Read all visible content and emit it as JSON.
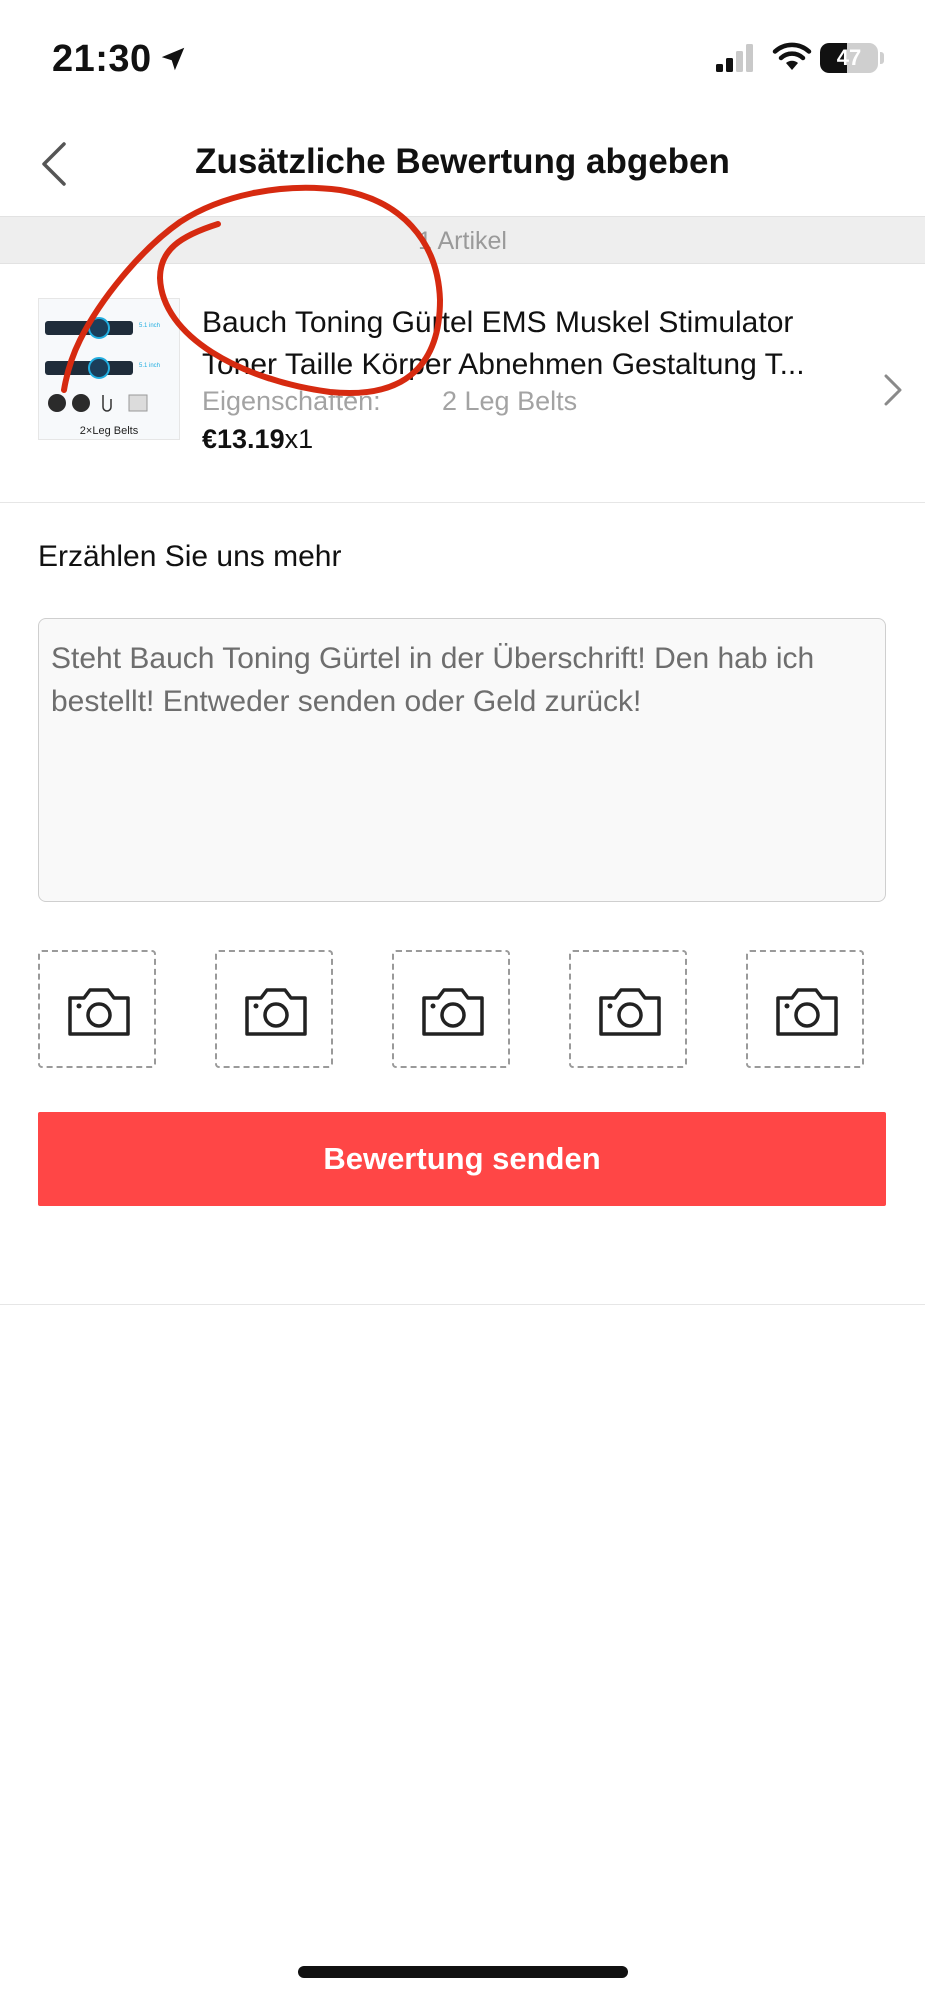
{
  "status_bar": {
    "time": "21:30",
    "battery_level": "47",
    "battery_fraction": 0.47,
    "icons": [
      "location-arrow-icon",
      "cellular-signal-icon",
      "wifi-icon",
      "battery-icon"
    ]
  },
  "header": {
    "title": "Zusätzliche Bewertung abgeben",
    "back_icon": "chevron-left-icon"
  },
  "section": {
    "label": "1 Artikel"
  },
  "product": {
    "title_line1": "Bauch Toning Gürtel EMS Muskel Stimulator",
    "title_line2": "Toner Taille Körper Abnehmen Gestaltung T...",
    "attribute_label": "Eigenschaften:",
    "attribute_value": "2 Leg Belts",
    "price": "€13.19",
    "quantity": "x1",
    "image_caption": "2×Leg Belts",
    "chevron_icon": "chevron-right-icon"
  },
  "review": {
    "label": "Erzählen Sie uns mehr",
    "text": "Steht Bauch Toning Gürtel in der Überschrift! Den hab ich bestellt! Entweder senden oder Geld zurück!"
  },
  "photos": {
    "slot_count": 5,
    "icon": "camera-icon"
  },
  "submit": {
    "label": "Bewertung senden"
  },
  "colors": {
    "accent": "#ff4646",
    "annotation": "#d62a10",
    "band": "#eeeeee",
    "muted_text": "#a3a3a3"
  }
}
